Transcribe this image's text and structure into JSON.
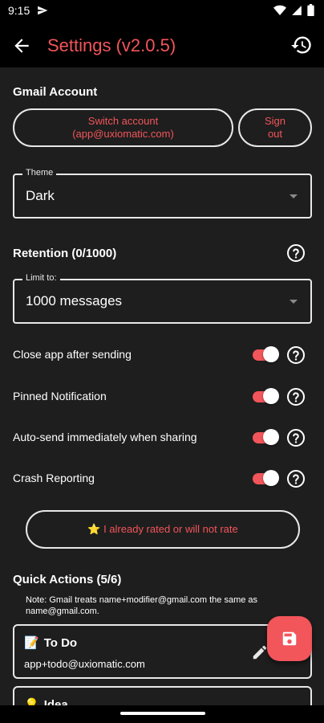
{
  "status_bar": {
    "time": "9:15"
  },
  "app_bar": {
    "title": "Settings (v2.0.5)"
  },
  "gmail": {
    "section_title": "Gmail Account",
    "switch_line1": "Switch account",
    "switch_line2": "(app@uxiomatic.com)",
    "signout_line1": "Sign",
    "signout_line2": "out"
  },
  "theme": {
    "label": "Theme",
    "value": "Dark"
  },
  "retention": {
    "title": "Retention (0/1000)",
    "limit_label": "Limit to:",
    "limit_value": "1000 messages"
  },
  "toggles": [
    {
      "label": "Close app after sending",
      "on": true
    },
    {
      "label": "Pinned Notification",
      "on": true
    },
    {
      "label": "Auto-send immediately when sharing",
      "on": true
    },
    {
      "label": "Crash Reporting",
      "on": true
    }
  ],
  "rate_button": {
    "label": "⭐ I already rated or will not rate"
  },
  "quick_actions": {
    "title": "Quick Actions (5/6)",
    "note": "Note: Gmail treats name+modifier@gmail.com the same as name@gmail.com.",
    "items": [
      {
        "emoji": "📝",
        "name": "To Do",
        "address": "app+todo@uxiomatic.com"
      },
      {
        "emoji": "💡",
        "name": "Idea",
        "address": ""
      }
    ]
  },
  "colors": {
    "accent": "#f2555a",
    "background": "#1e1e1e",
    "bar": "#000000",
    "outline": "#e8e8e8"
  },
  "icons": {
    "back": "arrow-left-icon",
    "history": "history-icon",
    "help": "help-circle-icon",
    "edit": "pencil-icon",
    "save": "save-icon"
  }
}
